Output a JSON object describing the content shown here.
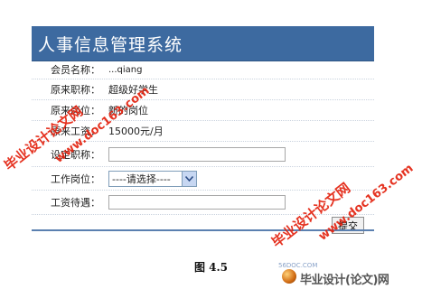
{
  "app": {
    "title": "人事信息管理系统"
  },
  "form": {
    "rows": [
      {
        "label": "会员名称：",
        "value": "...qiang"
      },
      {
        "label": "原来职称：",
        "value": "超级好学生"
      },
      {
        "label": "原来岗位：",
        "value": "新的岗位"
      },
      {
        "label": "原来工资：",
        "value": "15000元/月"
      }
    ],
    "fields": {
      "title_label": "设定职称：",
      "title_value": "",
      "position_label": "工作岗位：",
      "position_select": "----请选择----",
      "salary_label": "工资待遇：",
      "salary_value": ""
    },
    "submit_label": "提交"
  },
  "caption": "图 4.5",
  "watermarks": {
    "left_cn": "毕业设计论文网",
    "left_url": "www.doc163.com",
    "right_cn": "毕业设计论文网",
    "right_url": "www.doc163.com"
  },
  "logo": {
    "url": "56DOC.COM",
    "text": "毕业设计(论文)网"
  },
  "colors": {
    "header": "#3d6aa0",
    "watermark": "#e3220f"
  }
}
